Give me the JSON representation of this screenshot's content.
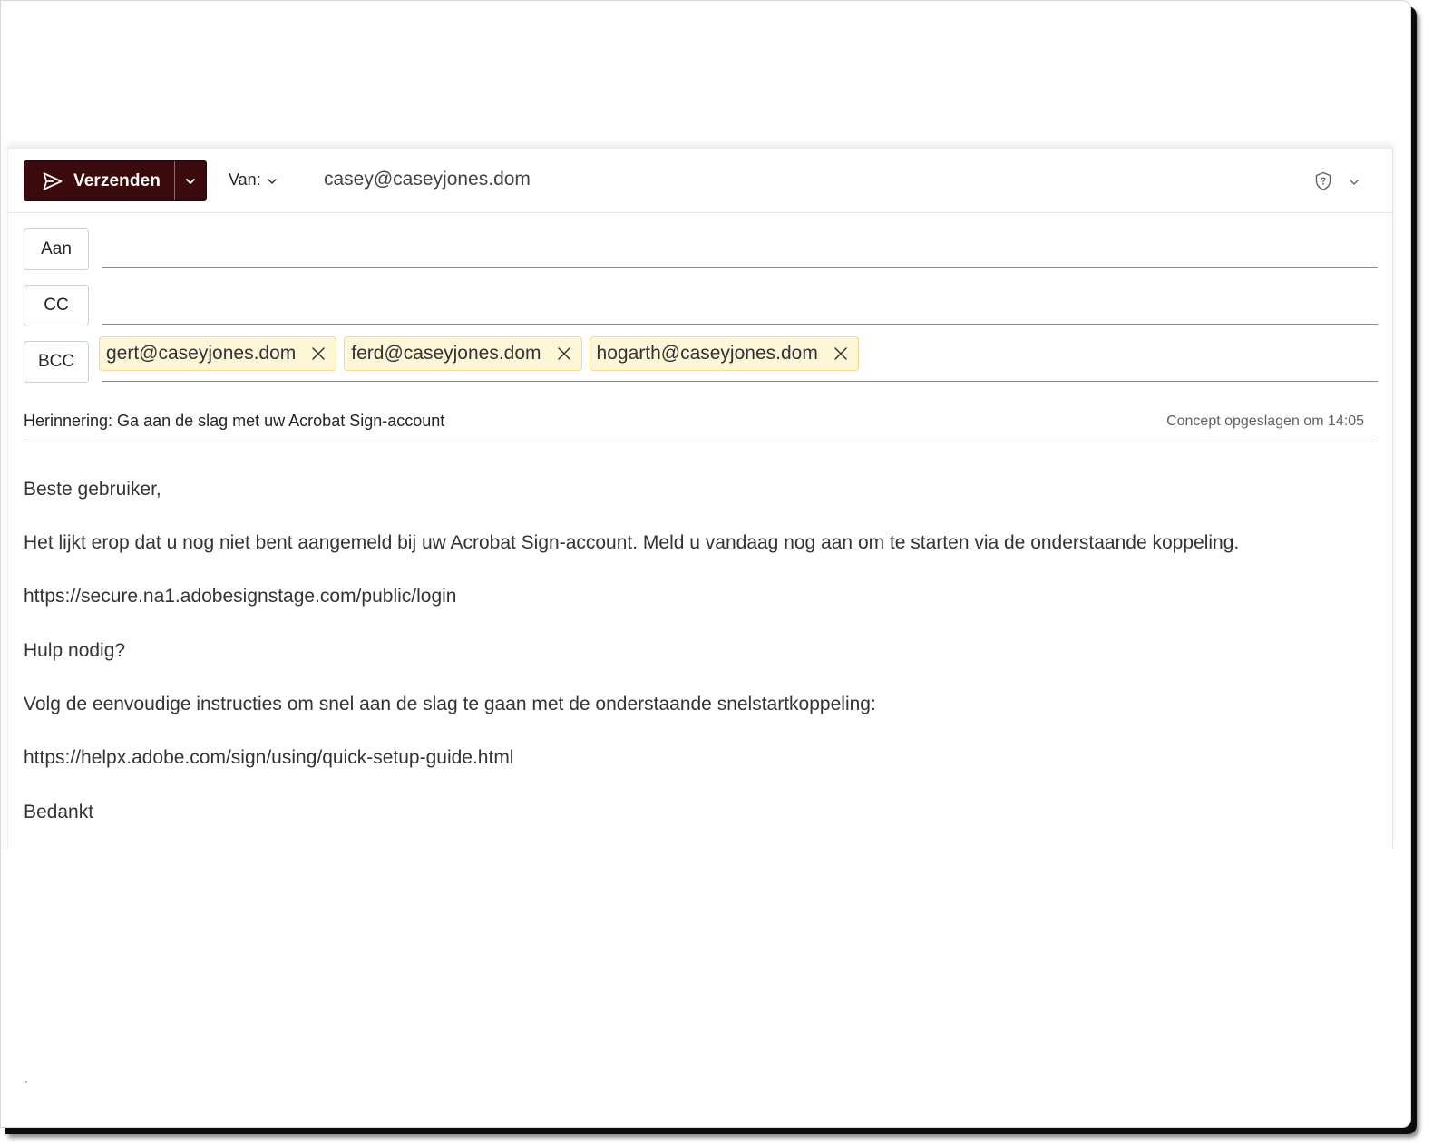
{
  "toolbar": {
    "send_label": "Verzenden",
    "from_label": "Van:",
    "from_value": "casey@caseyjones.dom",
    "icons": [
      "send-icon",
      "chevron-down-icon",
      "shield-icon"
    ]
  },
  "recipients": {
    "to_label": "Aan",
    "cc_label": "CC",
    "bcc_label": "BCC",
    "to": [],
    "cc": [],
    "bcc": [
      "gert@caseyjones.dom",
      "ferd@caseyjones.dom",
      "hogarth@caseyjones.dom"
    ]
  },
  "subject": {
    "value": "Herinnering: Ga aan de slag met uw Acrobat Sign-account",
    "saved_status": "Concept opgeslagen om 14:05"
  },
  "body": {
    "paragraphs": [
      "Beste gebruiker,",
      "Het lijkt erop dat u nog niet bent aangemeld bij uw Acrobat Sign-account. Meld u vandaag nog aan om te starten via de onderstaande koppeling.",
      "https://secure.na1.adobesignstage.com/public/login",
      "Hulp nodig?",
      "Volg de eenvoudige instructies om snel aan de slag te gaan met de onderstaande snelstartkoppeling:",
      "https://helpx.adobe.com/sign/using/quick-setup-guide.html",
      "Bedankt"
    ]
  },
  "colors": {
    "send_button": "#3b0a0c",
    "chip_background": "#fdf6d8",
    "chip_border": "#f2dc8a"
  }
}
